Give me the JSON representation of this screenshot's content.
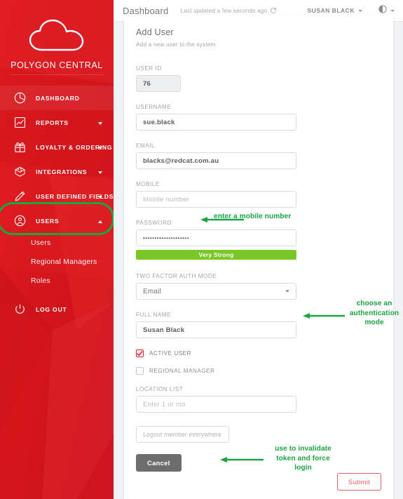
{
  "brand": {
    "name": "POLYGON CENTRAL",
    "logo_icon": "cloud-icon"
  },
  "sidebar": {
    "items": [
      {
        "label": "DASHBOARD",
        "icon": "pie-chart-icon",
        "active": true,
        "caret": "none"
      },
      {
        "label": "REPORTS",
        "icon": "line-chart-icon",
        "active": false,
        "caret": "down"
      },
      {
        "label": "LOYALTY & ORDERING",
        "icon": "gift-icon",
        "active": false,
        "caret": "down"
      },
      {
        "label": "INTEGRATIONS",
        "icon": "box-icon",
        "active": false,
        "caret": "down"
      },
      {
        "label": "USER DEFINED FIELDS",
        "icon": "pencil-icon",
        "active": false,
        "caret": "down"
      },
      {
        "label": "USERS",
        "icon": "user-icon",
        "active": false,
        "caret": "up"
      }
    ],
    "sub_items": [
      {
        "label": "Users"
      },
      {
        "label": "Regional Managers"
      },
      {
        "label": "Roles"
      }
    ],
    "logout": {
      "label": "LOG OUT",
      "icon": "power-icon"
    },
    "highlight_color": "#1ba641",
    "background_color": "#d8121a"
  },
  "topbar": {
    "title": "Dashboard",
    "updated_text": "Last updated a few seconds ago",
    "refresh_icon": "refresh-icon",
    "user_name": "SUSAN BLACK",
    "contrast_icon": "contrast-icon"
  },
  "card": {
    "title": "Add User",
    "subtitle": "Add a new user to the system",
    "fields": [
      {
        "label": "USER ID",
        "value": "76",
        "placeholder": "",
        "readonly": true
      },
      {
        "label": "USERNAME",
        "value": "sue.black",
        "placeholder": "",
        "readonly": false
      },
      {
        "label": "EMAIL",
        "value": "blacks@redcat.com.au",
        "placeholder": "",
        "readonly": false
      },
      {
        "label": "MOBILE",
        "value": "",
        "placeholder": "Mobile number",
        "readonly": false
      },
      {
        "label": "PASSWORD",
        "value": "••••••••••••••••••••",
        "placeholder": "",
        "readonly": false
      }
    ],
    "password_strength": {
      "label": "Very Strong",
      "color": "#7ac728"
    },
    "two_factor": {
      "label": "TWO FACTOR AUTH MODE",
      "value": "Email"
    },
    "full_name": {
      "label": "FULL NAME",
      "value": "Susan Black"
    },
    "checkboxes": [
      {
        "label": "ACTIVE USER",
        "checked": true
      },
      {
        "label": "REGIONAL MANAGER",
        "checked": false
      }
    ],
    "location_list": {
      "label": "LOCATION LIST",
      "placeholder": "Enter 1 or mo"
    },
    "logout_everywhere": {
      "placeholder": "Logout member everywhere"
    },
    "cancel_label": "Cancel",
    "submit_label": "Submit"
  },
  "annotations": [
    {
      "text": "enter a mobile number"
    },
    {
      "text": "choose an\nauthentication\nmode",
      "line1": "choose an",
      "line2": "authentication",
      "line3": "mode"
    },
    {
      "text": "use to invalidate token and force login",
      "line1": "use to invalidate",
      "line2": "token and force",
      "line3": "login"
    }
  ]
}
